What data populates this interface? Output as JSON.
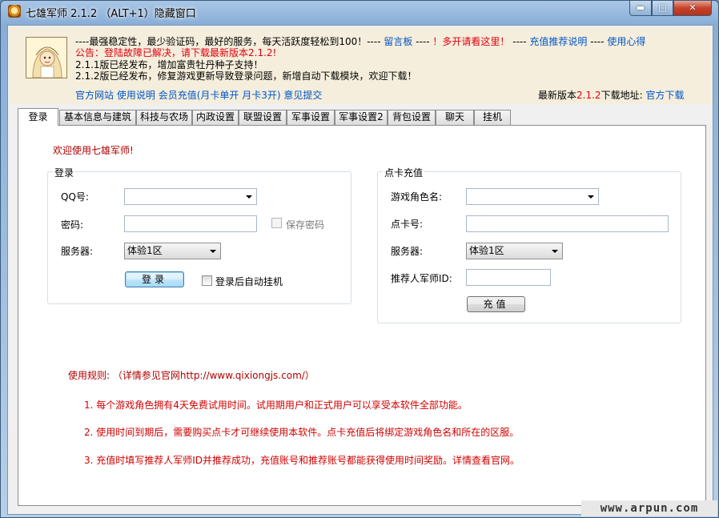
{
  "window": {
    "title": "七雄军师 2.1.2 （ALT+1）隐藏窗口",
    "min_glyph": "▬",
    "max_glyph": "□",
    "close_glyph": "✕"
  },
  "banner": {
    "line1_text": "----最强稳定性，最少验证码，最好的服务，每天活跃度轻松到100！----",
    "line1_link1": "留言板",
    "line1_sep1": "----",
    "line1_hot": "！多开请看这里！",
    "line1_sep2": "----",
    "line1_link2": "充值推荐说明",
    "line1_sep3": "----",
    "line1_link3": "使用心得",
    "notice": "公告：登陆故障已解决，请下载最新版本2.1.2!",
    "release1": "2.1.1版已经发布，增加富贵牡丹种子支持！",
    "release2": "2.1.2版已经发布，修复游戏更新导致登录问题，新增自动下载模块，欢迎下载！",
    "links": {
      "official_site": "官方网站",
      "usage": "使用说明",
      "member_recharge": "会员充值",
      "monthly": "(月卡单开",
      "monthly3": "月卡3开)",
      "feedback": "意见提交"
    },
    "latest_label": "最新版本",
    "latest_version": "2.1.2",
    "download_label": "下载地址:",
    "download_link": "官方下载"
  },
  "tabs": [
    "登录",
    "基本信息与建筑",
    "科技与农场",
    "内政设置",
    "联盟设置",
    "军事设置",
    "军事设置2",
    "背包设置",
    "聊天",
    "挂机"
  ],
  "active_tab": "登录",
  "login_panel": {
    "welcome": "欢迎使用七雄军师!",
    "login_group": {
      "title": "登录",
      "qq_label": "QQ号:",
      "qq_value": "",
      "password_label": "密码:",
      "password_value": "",
      "save_password_label": "保存密码",
      "server_label": "服务器:",
      "server_value": "体验1区",
      "login_button": "登录",
      "auto_hangup_label": "登录后自动挂机"
    },
    "recharge_group": {
      "title": "点卡充值",
      "role_label": "游戏角色名:",
      "role_value": "",
      "card_label": "点卡号:",
      "card_value": "",
      "server_label": "服务器:",
      "server_value": "体验1区",
      "referrer_label": "推荐人军师ID:",
      "referrer_value": "",
      "recharge_button": "充值"
    },
    "rules": {
      "title": "使用规则:    （详情参见官网http://www.qixiongjs.com/）",
      "items": [
        "1. 每个游戏角色拥有4天免费试用时间。试用期用户和正式用户可以享受本软件全部功能。",
        "2. 使用时间到期后，需要购买点卡才可继续使用本软件。点卡充值后将绑定游戏角色名和所在的区服。",
        "3. 充值时填写推荐人军师ID并推荐成功，充值账号和推荐账号都能获得使用时间奖励。详情查看官网。"
      ]
    }
  },
  "watermark": "www.arpun.com",
  "colors": {
    "accent_red": "#e0000f",
    "link_blue": "#0055c8",
    "banner_bg": "#f5eedc",
    "rules_red": "#d00000"
  }
}
